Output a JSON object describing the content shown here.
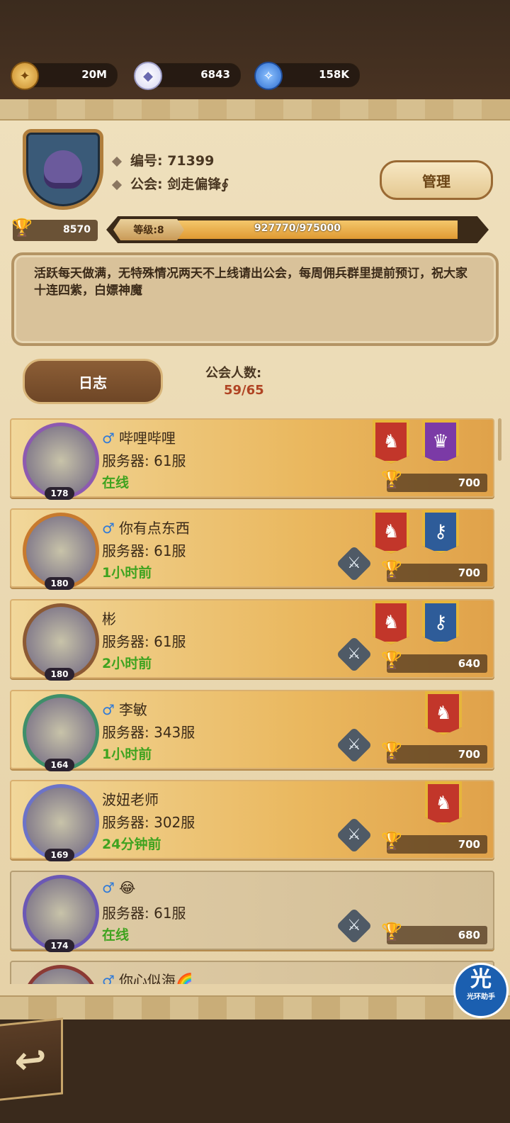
{
  "resources": {
    "gold": {
      "icon": "gold-coin-icon",
      "value": "20M"
    },
    "diamonds": {
      "icon": "diamond-icon",
      "value": "6843"
    },
    "essence": {
      "icon": "hero-essence-icon",
      "value": "158K"
    }
  },
  "guild": {
    "id_label": "编号: 71399",
    "name_label": "公会: 剑走偏锋∮",
    "manage_label": "管理",
    "trophies": "8570",
    "level_label": "等级:8",
    "exp_text": "927770/975000",
    "exp_progress": 0.9516,
    "notice": "活跃每天做满，无特殊情况两天不上线请出公会，每周佣兵群里提前预订，祝大家十连四紫，白嫖神魔",
    "log_label": "日志",
    "member_count_label": "公会人数:",
    "member_count": "59/65"
  },
  "members": [
    {
      "gender": "♂",
      "name": "哔哩哔哩",
      "level": "178",
      "server": "服务器: 61服",
      "status": "在线",
      "trophies": "700",
      "banners": [
        "red",
        "purple"
      ],
      "swords": false
    },
    {
      "gender": "♂",
      "name": "你有点东西",
      "level": "180",
      "server": "服务器: 61服",
      "status": "1小时前",
      "trophies": "700",
      "banners": [
        "red",
        "blue"
      ],
      "swords": true
    },
    {
      "gender": "",
      "name": "彬",
      "level": "180",
      "server": "服务器: 61服",
      "status": "2小时前",
      "trophies": "640",
      "banners": [
        "red",
        "blue"
      ],
      "swords": true
    },
    {
      "gender": "♂",
      "name": "李敏",
      "level": "164",
      "server": "服务器: 343服",
      "status": "1小时前",
      "trophies": "700",
      "banners": [
        "red"
      ],
      "swords": true
    },
    {
      "gender": "",
      "name": "波妞老师",
      "level": "169",
      "server": "服务器: 302服",
      "status": "24分钟前",
      "trophies": "700",
      "banners": [
        "red"
      ],
      "swords": true
    },
    {
      "gender": "♂",
      "name": "😂",
      "level": "174",
      "server": "服务器: 61服",
      "status": "在线",
      "trophies": "680",
      "banners": [],
      "swords": true
    },
    {
      "gender": "♂",
      "name": "你心似海🌈",
      "level": "",
      "server": "",
      "status": "",
      "trophies": "",
      "banners": [],
      "swords": false
    }
  ],
  "helper": {
    "glyph": "光",
    "label": "光环助手"
  },
  "colors": {
    "online": "#3fa320",
    "count_red": "#b04423",
    "panel": "#efe0bd"
  }
}
